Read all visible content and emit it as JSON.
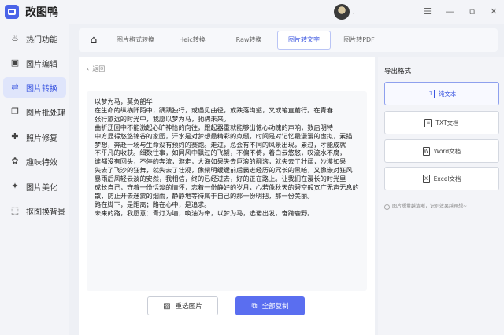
{
  "app": {
    "title": "改图鸭",
    "user_name": "."
  },
  "window_controls": [
    "☰",
    "—",
    "⧉",
    "✕"
  ],
  "sidebar": {
    "items": [
      {
        "label": "热门功能",
        "icon": "flame-icon",
        "glyph": "♨"
      },
      {
        "label": "图片编辑",
        "icon": "image-edit-icon",
        "glyph": "▣"
      },
      {
        "label": "图片转换",
        "icon": "convert-icon",
        "glyph": "⇄"
      },
      {
        "label": "图片批处理",
        "icon": "batch-icon",
        "glyph": "❐"
      },
      {
        "label": "照片修复",
        "icon": "repair-icon",
        "glyph": "✚"
      },
      {
        "label": "趣味特效",
        "icon": "effects-icon",
        "glyph": "✿"
      },
      {
        "label": "图片美化",
        "icon": "beautify-icon",
        "glyph": "✦"
      },
      {
        "label": "抠图换背景",
        "icon": "cutout-icon",
        "glyph": "⬚"
      }
    ],
    "active_index": 2
  },
  "tabs": {
    "items": [
      "图片格式转换",
      "Heic转换",
      "Raw转换",
      "图片转文字",
      "图片转PDF"
    ],
    "active_index": 3
  },
  "main": {
    "back_label": "返回",
    "result_lines": [
      "以梦为马，莫负韶华",
      "在生命的纵横阡陌中，踽踽独行，或遇见曲径，或跌落沟壑，又或笔直前行。在青春",
      "张行旅远的时光中，我愿以梦为马，驰骋未来。",
      "曲折迂回中不能激起心旷神怡的向往，跟起器重就能够出惊心动魄的声响，数启明特",
      "中方显得悠悠锦谷的家园，汗水是对梦想最精彩的点缀，时间是对记忆最漫漫的虚拟，素描",
      "梦想，奔赴一场与生命没有预约的赛跑。走过，总会有不同的风景出现，累过，才能成就",
      "不平凡的收获。细数往事，如同风中飘过的飞絮，不偏不倚，着白云悠悠，叹流水不腐，",
      "谁都没有回头，不停的奔流，游走，大海如果失去巨浪的翻滚，就失去了壮阔，沙漠如果",
      "失去了飞沙的狂舞，就失去了壮观，像柴明缓缓前后霸迸经历的冗长的黑暗，又像嵌对狂风",
      "暴雨后风轻云淡的安然，我相信，终的已经过去，好的正在路上。让我们在漫长的时光里",
      "成长自己，守着一份恬淡的情怀，恋着一份静好的岁月，心若像秋天的碧空般宽广无声无息的飘散",
      "散，防止开去迷蒙的烟雨，静静地等待属于自己的那一份明把，那一份美丽。",
      "路在脚下，是距离；路在心中，是追求。",
      "未来的路，我愿意：青灯为墙，唤油为帝，以梦为马，选诺出发，奋跨鹿野。"
    ]
  },
  "actions": {
    "reselect_label": "重选图片",
    "copy_all_label": "全部复制"
  },
  "export_panel": {
    "title": "导出格式",
    "formats": [
      {
        "label": "纯文本",
        "icon": "text-file-icon",
        "glyph": "T"
      },
      {
        "label": "TXT文档",
        "icon": "txt-file-icon",
        "glyph": "≡"
      },
      {
        "label": "Word文档",
        "icon": "word-file-icon",
        "glyph": "W"
      },
      {
        "label": "Excel文档",
        "icon": "excel-file-icon",
        "glyph": "X"
      }
    ],
    "active_index": 0,
    "note": "图片质量越清晰，识别效果越理想~"
  },
  "colors": {
    "accent": "#3a55e0",
    "primary_button": "#5a6ef0",
    "active_nav_bg": "#dfe5fb"
  }
}
